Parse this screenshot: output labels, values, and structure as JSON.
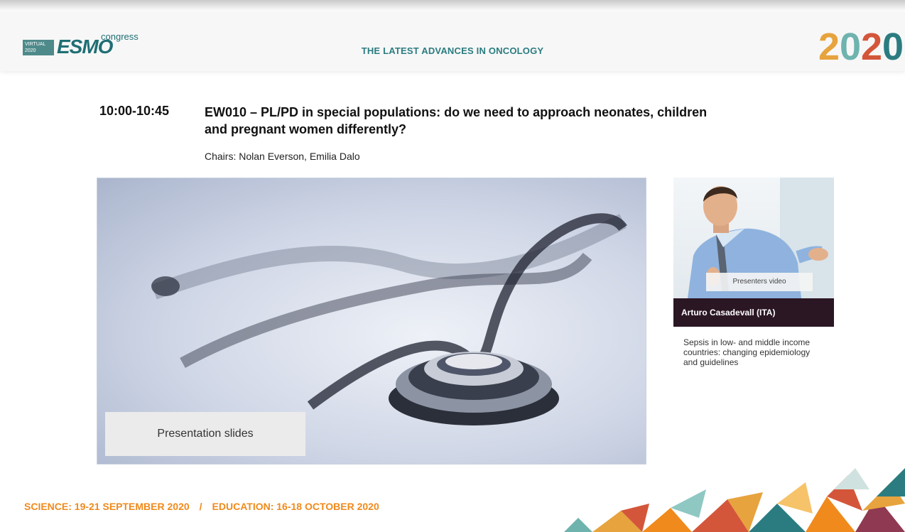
{
  "header": {
    "logo_virtual": "VIRTUAL 2020",
    "logo_esmo": "ESMO",
    "logo_congress": "congress",
    "tagline": "THE LATEST ADVANCES IN ONCOLOGY",
    "year_digits": [
      "2",
      "0",
      "2",
      "0"
    ],
    "year_colors": [
      "#e7a33d",
      "#6fb3ae",
      "#d4563a",
      "#2b7c80"
    ]
  },
  "session": {
    "time": "10:00-10:45",
    "title": "EW010 – PL/PD in special populations: do we need to approach neonates, children and pregnant women differently?",
    "chairs": "Chairs: Nolan Everson, Emilia Dalo"
  },
  "slides": {
    "label": "Presentation slides"
  },
  "presenter": {
    "video_label": "Presenters video",
    "name": "Arturo Casadevall (ITA)",
    "talk": "Sepsis in low- and middle income countries: changing epidemiology and guidelines"
  },
  "footer": {
    "science": "SCIENCE: 19-21 SEPTEMBER 2020",
    "separator": "/",
    "education": "EDUCATION: 16-18 OCTOBER 2020"
  },
  "colors": {
    "accent_teal": "#2b7c80",
    "footer_orange": "#f08a1c",
    "name_bar": "#2b1624"
  }
}
